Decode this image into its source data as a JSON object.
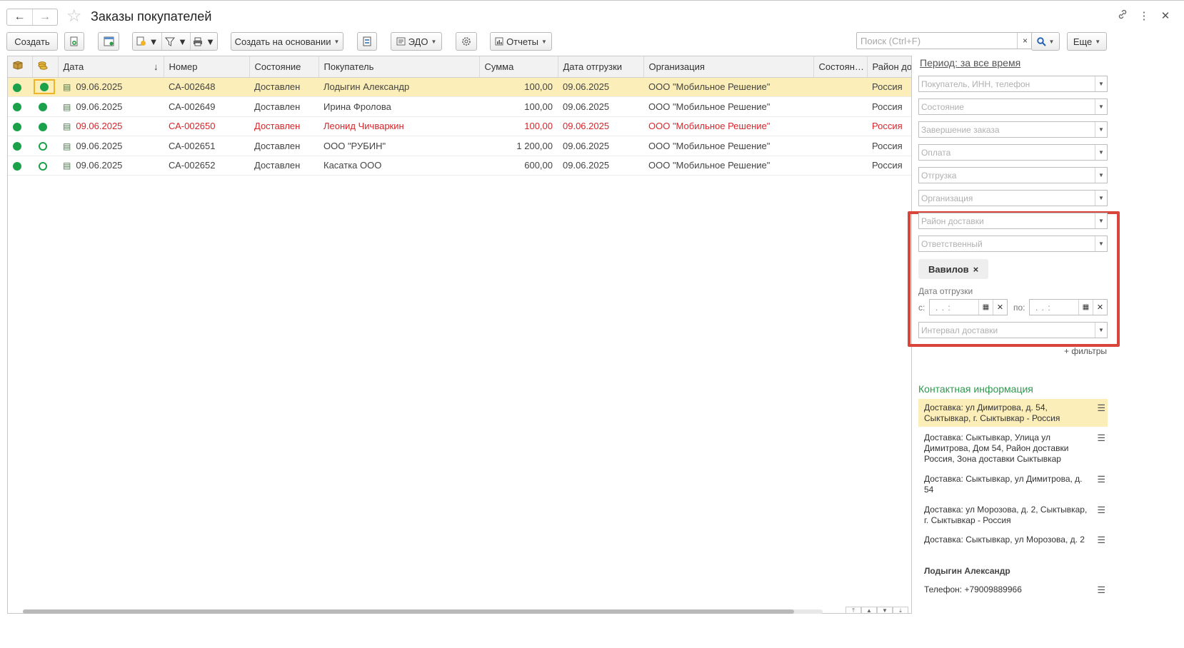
{
  "window": {
    "title": "Заказы покупателей",
    "back_icon": "←",
    "forward_icon": "→",
    "star_icon": "☆",
    "link_icon": "🔗",
    "more_icon": "⋮",
    "close_icon": "✕"
  },
  "toolbar": {
    "create_label": "Создать",
    "create_based_label": "Создать на основании",
    "edo_label": "ЭДО",
    "reports_label": "Отчеты",
    "more_label": "Еще",
    "search_placeholder": "Поиск (Ctrl+F)",
    "search_clear": "×",
    "search_icon": "🔍"
  },
  "table": {
    "columns": {
      "c1": "",
      "c2": "",
      "date": "Дата",
      "number": "Номер",
      "state": "Состояние",
      "buyer": "Покупатель",
      "sum": "Сумма",
      "ship_date": "Дата отгрузки",
      "org": "Организация",
      "state2": "Состоян…",
      "district": "Район до"
    },
    "sort_indicator": "↓",
    "rows": [
      {
        "date": "09.06.2025",
        "number": "СА-002648",
        "state": "Доставлен",
        "buyer": "Лодыгин Александр",
        "sum": "100,00",
        "ship_date": "09.06.2025",
        "org": "ООО \"Мобильное Решение\"",
        "state2": "",
        "district": "Россия"
      },
      {
        "date": "09.06.2025",
        "number": "СА-002649",
        "state": "Доставлен",
        "buyer": "Ирина Фролова",
        "sum": "100,00",
        "ship_date": "09.06.2025",
        "org": "ООО \"Мобильное Решение\"",
        "state2": "",
        "district": "Россия"
      },
      {
        "date": "09.06.2025",
        "number": "СА-002650",
        "state": "Доставлен",
        "buyer": "Леонид Чичваркин",
        "sum": "100,00",
        "ship_date": "09.06.2025",
        "org": "ООО \"Мобильное Решение\"",
        "state2": "",
        "district": "Россия"
      },
      {
        "date": "09.06.2025",
        "number": "СА-002651",
        "state": "Доставлен",
        "buyer": "ООО \"РУБИН\"",
        "sum": "1 200,00",
        "ship_date": "09.06.2025",
        "org": "ООО \"Мобильное Решение\"",
        "state2": "",
        "district": "Россия"
      },
      {
        "date": "09.06.2025",
        "number": "СА-002652",
        "state": "Доставлен",
        "buyer": "Касатка ООО",
        "sum": "600,00",
        "ship_date": "09.06.2025",
        "org": "ООО \"Мобильное Решение\"",
        "state2": "",
        "district": "Россия"
      }
    ]
  },
  "filters": {
    "period": "Период: за все время",
    "buyer_ph": "Покупатель, ИНН, телефон",
    "state_ph": "Состояние",
    "completion_ph": "Завершение заказа",
    "payment_ph": "Оплата",
    "shipment_ph": "Отгрузка",
    "org_ph": "Организация",
    "district_ph": "Район доставки",
    "responsible_ph": "Ответственный",
    "tag_label": "Вавилов",
    "tag_remove": "×",
    "ship_date_label": "Дата отгрузки",
    "from_label": "с:",
    "to_label": "по:",
    "date_mask": ". .     :",
    "interval_ph": "Интервал доставки",
    "more_filters": "+ фильтры"
  },
  "contacts": {
    "title": "Контактная информация",
    "items": [
      "Доставка: ул Димитрова, д. 54, Сыктывкар, г. Сыктывкар - Россия",
      "Доставка: Сыктывкар, Улица ул Димитрова, Дом 54, Район доставки Россия, Зона доставки Сыктывкар",
      "Доставка: Сыктывкар, ул Димитрова, д. 54",
      "Доставка: ул Морозова, д. 2, Сыктывкар, г. Сыктывкар - Россия",
      "Доставка: Сыктывкар, ул Морозова, д. 2"
    ],
    "person_name": "Лодыгин Александр",
    "phone": "Телефон: +79009889966"
  },
  "colors": {
    "accent_green": "#1aa14a",
    "selection": "#fbeeb8",
    "error_red": "#d6262b",
    "highlight_box": "#d9443b"
  }
}
